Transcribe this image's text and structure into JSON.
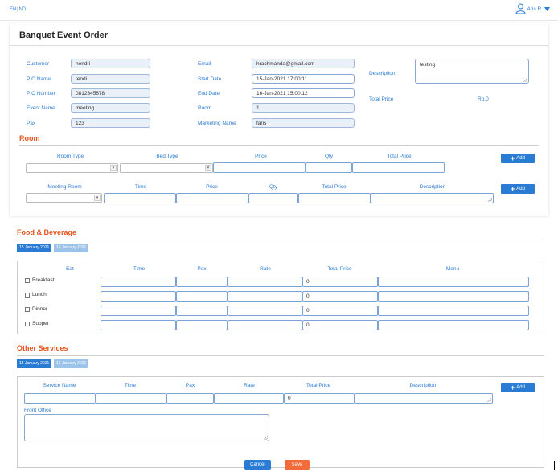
{
  "topbar": {
    "lang_en": "EN",
    "lang_sep": "|",
    "lang_ind": "IND",
    "user_name": "Aris R."
  },
  "page_title": "Banquet Event Order",
  "form": {
    "customer_label": "Customer",
    "customer": "hendri",
    "pic_name_label": "PIC Name",
    "pic_name": "tendi",
    "pic_number_label": "PIC Number",
    "pic_number": "0812345678",
    "event_name_label": "Event Name",
    "event_name": "meeting",
    "pax_label": "Pax",
    "pax": "123",
    "email_label": "Email",
    "email": "hrachmanda@gmail.com",
    "start_date_label": "Start Date",
    "start_date": "15-Jan-2021 17:00:11",
    "end_date_label": "End Date",
    "end_date": "16-Jan-2021 15:00:12",
    "room_label": "Room",
    "room": "1",
    "marketing_label": "Marketing Name",
    "marketing": "faris",
    "description_label": "Description",
    "description": "testing",
    "total_price_label": "Total Price",
    "total_price": "Rp.0"
  },
  "room_section": {
    "title": "Room",
    "headers": [
      "Room Type",
      "Bed Type",
      "Price",
      "Qty",
      "Total Price"
    ],
    "add_label": "Add",
    "meeting_headers": [
      "Meeting Room",
      "Time",
      "Price",
      "Qty",
      "Total Price",
      "Description"
    ],
    "meeting_add_label": "Add"
  },
  "fnb": {
    "title": "Food & Beverage",
    "date_tabs": [
      "15 January 2021",
      "16 January 2021"
    ],
    "headers": [
      "Eat",
      "Time",
      "Pax",
      "Rate",
      "Total Price",
      "Menu"
    ],
    "rows": [
      {
        "label": "Breakfast",
        "total": "0"
      },
      {
        "label": "Lunch",
        "total": "0"
      },
      {
        "label": "Dinner",
        "total": "0"
      },
      {
        "label": "Supper",
        "total": "0"
      }
    ]
  },
  "other": {
    "title": "Other Services",
    "date_tabs": [
      "15 January 2021",
      "16 January 2021"
    ],
    "headers": [
      "Service Name",
      "Time",
      "Pax",
      "Rate",
      "Total Price",
      "Description"
    ],
    "add_label": "Add",
    "total": "0",
    "front_office_label": "Front Office"
  },
  "actions": {
    "cancel": "Cancel",
    "save": "Save"
  },
  "colors": {
    "accent": "#2a7bd4",
    "section": "#e8541e",
    "save": "#f26b3a"
  }
}
